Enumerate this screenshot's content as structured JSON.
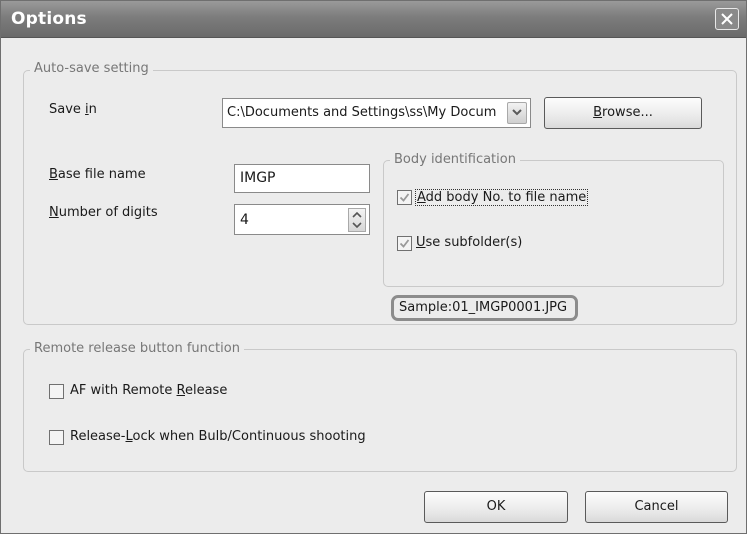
{
  "window": {
    "title": "Options"
  },
  "autosave": {
    "legend": "Auto-save setting",
    "save_in": {
      "label_pre": "Save ",
      "label_key": "i",
      "label_post": "n",
      "value": "C:\\Documents and Settings\\ss\\My Docum"
    },
    "browse": {
      "key": "B",
      "rest": "rowse..."
    },
    "base_name": {
      "label_key": "B",
      "label_rest": "ase file name",
      "value": "IMGP"
    },
    "digits": {
      "label_key": "N",
      "label_rest": "umber of digits",
      "value": "4"
    },
    "body_id": {
      "legend": "Body identification",
      "add_body": {
        "key": "A",
        "rest": "dd body No. to file name",
        "checked": true
      },
      "use_sub": {
        "key": "U",
        "rest": "se subfolder(s)",
        "checked": true
      }
    },
    "sample": "Sample:01_IMGP0001.JPG"
  },
  "remote": {
    "legend": "Remote release button function",
    "af": {
      "pre": "AF with Remote ",
      "key": "R",
      "post": "elease",
      "checked": false
    },
    "lock": {
      "pre": "Release-",
      "key": "L",
      "post": "ock when Bulb/Continuous shooting",
      "checked": false
    }
  },
  "buttons": {
    "ok": "OK",
    "cancel": "Cancel"
  }
}
